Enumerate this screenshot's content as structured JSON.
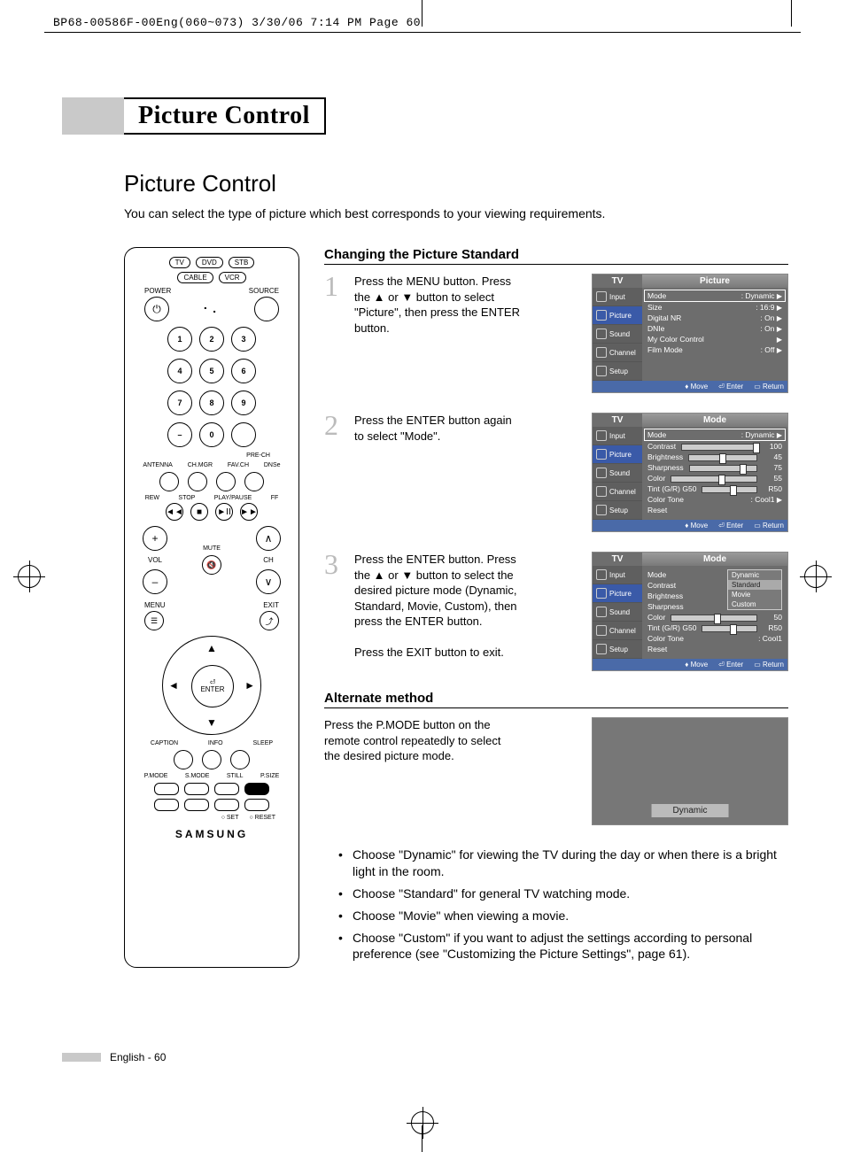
{
  "print_header": "BP68-00586F-00Eng(060~073)  3/30/06  7:14 PM  Page 60",
  "chapter_title": "Picture Control",
  "section_title": "Picture Control",
  "intro": "You can select the type of picture which best corresponds to your viewing requirements.",
  "remote": {
    "modes_top": [
      "TV",
      "DVD",
      "STB"
    ],
    "modes_bottom": [
      "CABLE",
      "VCR"
    ],
    "power_label": "POWER",
    "source_label": "SOURCE",
    "numpad": [
      "1",
      "2",
      "3",
      "4",
      "5",
      "6",
      "7",
      "8",
      "9",
      "–",
      "0"
    ],
    "prech_label": "PRE-CH",
    "row_labels_1": [
      "ANTENNA",
      "CH.MGR",
      "FAV.CH",
      "DNSe"
    ],
    "row_labels_2": [
      "REW",
      "STOP",
      "PLAY/PAUSE",
      "FF"
    ],
    "vol_label": "VOL",
    "ch_label": "CH",
    "mute_label": "MUTE",
    "menu_label": "MENU",
    "exit_label": "EXIT",
    "enter_label": "ENTER",
    "row_labels_3": [
      "CAPTION",
      "INFO",
      "SLEEP"
    ],
    "row_labels_4": [
      "P.MODE",
      "S.MODE",
      "STILL",
      "P.SIZE"
    ],
    "set_label": "SET",
    "reset_label": "RESET",
    "brand": "SAMSUNG"
  },
  "subhead_1": "Changing the Picture Standard",
  "steps": [
    {
      "num": "1",
      "text": "Press the MENU button. Press the ▲ or ▼ button to select \"Picture\", then press the ENTER button."
    },
    {
      "num": "2",
      "text": "Press the ENTER button again to select \"Mode\"."
    },
    {
      "num": "3",
      "text": "Press the ENTER button. Press the ▲ or ▼ button to select the desired picture mode (Dynamic, Standard, Movie, Custom), then press the ENTER button.",
      "extra": "Press the EXIT button to exit."
    }
  ],
  "osd_common": {
    "tv_label": "TV",
    "side_items": [
      "Input",
      "Picture",
      "Sound",
      "Channel",
      "Setup"
    ],
    "foot": {
      "move": "Move",
      "enter": "Enter",
      "return": "Return"
    }
  },
  "osd1": {
    "title": "Picture",
    "rows": [
      {
        "k": "Mode",
        "v": ": Dynamic",
        "arrow": true,
        "boxed": true
      },
      {
        "k": "Size",
        "v": ": 16:9",
        "arrow": true
      },
      {
        "k": "Digital NR",
        "v": ": On",
        "arrow": true
      },
      {
        "k": "DNIe",
        "v": ": On",
        "arrow": true
      },
      {
        "k": "My Color Control",
        "v": "",
        "arrow": true
      },
      {
        "k": "Film Mode",
        "v": ": Off",
        "arrow": true
      }
    ]
  },
  "osd2": {
    "title": "Mode",
    "rows": [
      {
        "k": "Mode",
        "v": ": Dynamic",
        "arrow": true,
        "boxed": true
      },
      {
        "k": "Contrast",
        "slider": 95,
        "val": "100"
      },
      {
        "k": "Brightness",
        "slider": 45,
        "val": "45"
      },
      {
        "k": "Sharpness",
        "slider": 75,
        "val": "75"
      },
      {
        "k": "Color",
        "slider": 55,
        "val": "55"
      },
      {
        "k": "Tint (G/R) G50",
        "slider": 50,
        "val": "R50"
      },
      {
        "k": "Color Tone",
        "v": ": Cool1",
        "arrow": true
      },
      {
        "k": "Reset",
        "v": "",
        "arrow": false
      }
    ]
  },
  "osd3": {
    "title": "Mode",
    "mode_options": [
      "Dynamic",
      "Standard",
      "Movie",
      "Custom"
    ],
    "rows": [
      {
        "k": "Mode",
        "v": ""
      },
      {
        "k": "Contrast",
        "v": ""
      },
      {
        "k": "Brightness",
        "v": ""
      },
      {
        "k": "Sharpness",
        "v": ""
      },
      {
        "k": "Color",
        "slider": 50,
        "val": "50"
      },
      {
        "k": "Tint (G/R) G50",
        "slider": 50,
        "val": "R50"
      },
      {
        "k": "Color Tone",
        "v": ": Cool1"
      },
      {
        "k": "Reset",
        "v": ""
      }
    ]
  },
  "subhead_2": "Alternate method",
  "alt_text": "Press the P.MODE button on the remote control repeatedly to select the desired picture mode.",
  "alt_overlay": "Dynamic",
  "bullets": [
    "Choose \"Dynamic\" for viewing the TV during the day or when there is a bright light in the room.",
    "Choose \"Standard\" for general TV watching mode.",
    "Choose \"Movie\" when viewing a movie.",
    "Choose \"Custom\" if you want to adjust the settings according to personal preference (see \"Customizing the Picture Settings\", page 61)."
  ],
  "footer": "English - 60"
}
